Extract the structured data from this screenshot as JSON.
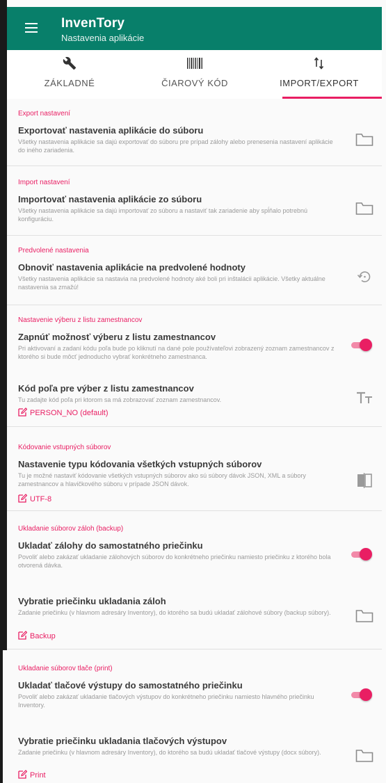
{
  "app": {
    "title": "InvenTory",
    "subtitle": "Nastavenia aplikácie"
  },
  "tabs": [
    {
      "label": "ZÁKLADNÉ",
      "icon": "wrench-icon"
    },
    {
      "label": "ČIAROVÝ KÓD",
      "icon": "barcode-icon"
    },
    {
      "label": "IMPORT/EXPORT",
      "icon": "swap-vertical-icon",
      "active": true
    }
  ],
  "sections": {
    "export": {
      "header": "Export nastavení",
      "title": "Exportovať nastavenia aplikácie do súboru",
      "desc": "Všetky nastavenia aplikácie sa dajú exportovať do súboru pre prípad zálohy alebo prenesenia nastavení aplikácie do iného zariadenia.",
      "icon": "folder-icon"
    },
    "import": {
      "header": "Import nastavení",
      "title": "Importovať nastavenia aplikácie zo súboru",
      "desc": "Všetky nastavenia aplikácie sa dajú importovať zo súboru a nastaviť tak zariadenie aby spĺňalo potrebnú konfiguráciu.",
      "icon": "folder-icon"
    },
    "defaults": {
      "header": "Predvolené nastavenia",
      "title": "Obnoviť nastavenia aplikácie na predvolené hodnoty",
      "desc": "Všetky nastavenia aplikácie sa nastavia na predvolené hodnoty aké boli pri inštalácii aplikácie. Všetky aktuálne nastavenia sa zmažú!",
      "icon": "restore-icon"
    },
    "employees": {
      "header": "Nastavenie výberu z listu zamestnancov",
      "item1": {
        "title": "Zapnúť možnosť výberu z listu zamestnancov",
        "desc": "Pri aktivovaní a zadaní kódu poľa bude po kliknutí na dané pole používateľovi zobrazený zoznam zamestnancov z ktorého si bude môcť jednoducho vybrať konkrétneho zamestnanca.",
        "toggle_on": true
      },
      "item2": {
        "title": "Kód poľa pre výber z listu zamestnancov",
        "desc": "Tu zadajte kód poľa pri ktorom sa má zobrazovať zoznam zamestnancov.",
        "value": "PERSON_NO (default)",
        "icon": "text-size-icon"
      }
    },
    "encoding": {
      "header": "Kódovanie vstupných súborov",
      "title": "Nastavenie typu kódovania všetkých vstupných súborov",
      "desc": "Tu je možné nastaviť kódovanie všetkých vstupných súborov ako sú súbory dávok JSON, XML a súbory zamestnancov a hlavičkového súboru v prípade JSON dávok.",
      "value": "UTF-8",
      "icon": "file-compare-icon"
    },
    "backup": {
      "header": "Ukladanie súborov záloh (backup)",
      "item1": {
        "title": "Ukladať zálohy do samostatného priečinku",
        "desc": "Povoliť alebo zakázať ukladanie zálohových súborov do konkrétneho priečinku namiesto priečinku z ktorého bola otvorená dávka.",
        "toggle_on": true
      },
      "item2": {
        "title": "Vybratie priečinku ukladania záloh",
        "desc": "Zadanie priečinku (v hlavnom adresáry Inventory), do ktorého sa budú ukladať zálohové súbory (backup súbory).",
        "value": "Backup",
        "icon": "folder-icon"
      }
    },
    "print": {
      "header": "Ukladanie súborov tlače (print)",
      "item1": {
        "title": "Ukladať tlačové výstupy do samostatného priečinku",
        "desc": "Povoliť alebo zakázať ukladanie tlačových výstupov do konkrétneho priečinku namiesto hlavného priečinku Inventory.",
        "toggle_on": true
      },
      "item2": {
        "title": "Vybratie priečinku ukladania tlačových výstupov",
        "desc": "Zadanie priečinku (v hlavnom adresáry Inventory), do ktorého sa budú ukladať tlačové výstupy (docx súbory).",
        "value": "Print",
        "icon": "folder-icon"
      }
    }
  },
  "colors": {
    "appbar": "#087f6a",
    "accent": "#e91e63"
  }
}
